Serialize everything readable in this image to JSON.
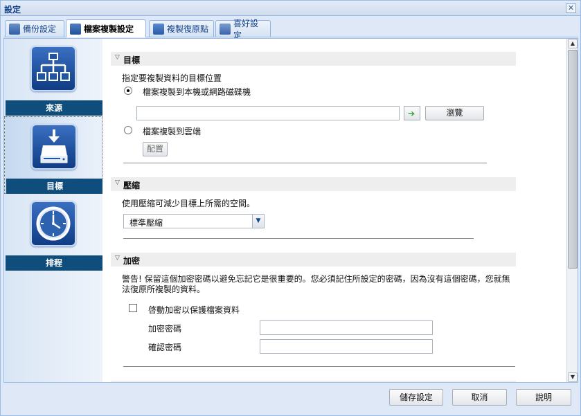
{
  "window": {
    "title": "設定",
    "close_symbol": "✕"
  },
  "tabs": [
    {
      "label": "備份設定"
    },
    {
      "label": "檔案複製設定"
    },
    {
      "label": "複製復原點"
    },
    {
      "label": "喜好設定"
    }
  ],
  "sidebar": {
    "items": [
      {
        "label": "來源",
        "icon": "network-source-icon"
      },
      {
        "label": "目標",
        "icon": "drive-destination-icon"
      },
      {
        "label": "排程",
        "icon": "clock-schedule-icon"
      }
    ],
    "selected": "目標"
  },
  "destination": {
    "header": "目標",
    "description": "指定要複製資料的目標位置",
    "option_local": "檔案複製到本機或網路磁碟機",
    "path_value": "",
    "browse_label": "瀏覽",
    "option_cloud": "檔案複製到雲端",
    "configure_label": "配置"
  },
  "compression": {
    "header": "壓縮",
    "description": "使用壓縮可減少目標上所需的空間。",
    "selected": "標準壓縮"
  },
  "encryption": {
    "header": "加密",
    "warning": "警告! 保留這個加密密碼以避免忘記它是很重要的。您必須記住所設定的密碼，因為沒有這個密碼，您就無法復原所複製的資料。",
    "enable_label": "啓動加密以保護檔案資料",
    "password_label": "加密密碼",
    "confirm_label": "確認密碼",
    "password_value": "",
    "confirm_value": ""
  },
  "footer": {
    "save_label": "儲存設定",
    "cancel_label": "取消",
    "help_label": "說明"
  },
  "colors": {
    "sidebar_label_bg": "#0f4d7c",
    "icon_bg": "#1f56a3",
    "title_text": "#15428b"
  }
}
